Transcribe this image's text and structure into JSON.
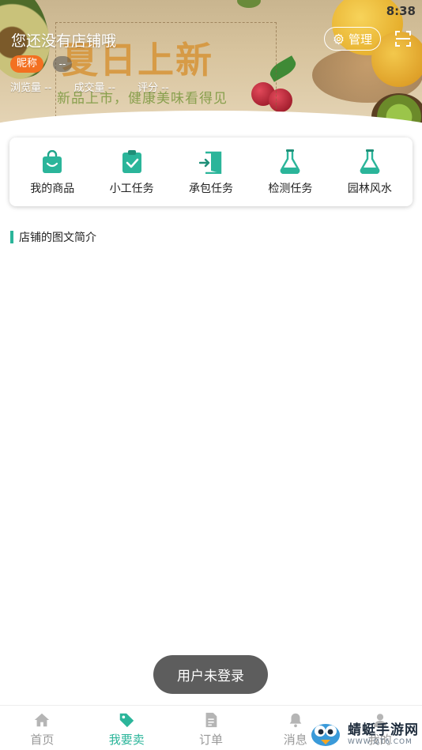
{
  "status_bar": {
    "time": "8:38"
  },
  "banner": {
    "promo_title": "夏日上新",
    "promo_subtitle": "新品上市，健康美味看得见"
  },
  "shop": {
    "title": "您还没有店铺哦",
    "nickname_label": "昵称",
    "nickname_value": "--",
    "stats": [
      {
        "label": "浏览量",
        "value": "--"
      },
      {
        "label": "成交量",
        "value": "--"
      },
      {
        "label": "评分",
        "value": "--"
      }
    ],
    "manage_label": "管理"
  },
  "actions": [
    {
      "label": "我的商品",
      "icon": "shopping-bag-icon"
    },
    {
      "label": "小工任务",
      "icon": "clipboard-check-icon"
    },
    {
      "label": "承包任务",
      "icon": "door-enter-icon"
    },
    {
      "label": "检测任务",
      "icon": "flask-icon"
    },
    {
      "label": "园林风水",
      "icon": "flask-icon"
    }
  ],
  "intro": {
    "heading": "店铺的图文简介"
  },
  "toast": {
    "text": "用户未登录"
  },
  "bottom_nav": [
    {
      "label": "首页",
      "icon": "home-icon",
      "active": false
    },
    {
      "label": "我要卖",
      "icon": "tag-icon",
      "active": true
    },
    {
      "label": "订单",
      "icon": "document-icon",
      "active": false
    },
    {
      "label": "消息",
      "icon": "bell-icon",
      "active": false
    },
    {
      "label": "我的",
      "icon": "user-icon",
      "active": false
    }
  ],
  "watermark": {
    "name": "蜻蜓手游网",
    "url": "WWW.QT6.COM"
  },
  "colors": {
    "accent": "#2bb59a",
    "badge": "#f37021",
    "inactive": "#999999"
  }
}
